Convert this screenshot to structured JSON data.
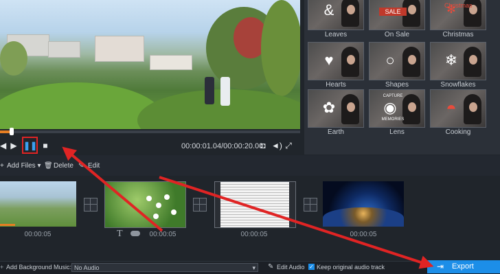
{
  "player": {
    "timecode": "00:00:01.04/00:00:20.00",
    "progress_fraction": 0.038
  },
  "effects": {
    "items": [
      {
        "label": "Leaves",
        "motif": "&"
      },
      {
        "label": "On Sale",
        "motif": "SALE"
      },
      {
        "label": "Christmas",
        "motif": "✻"
      },
      {
        "label": "Hearts",
        "motif": "♥"
      },
      {
        "label": "Shapes",
        "motif": "○"
      },
      {
        "label": "Snowflakes",
        "motif": "❄"
      },
      {
        "label": "Earth",
        "motif": "✿"
      },
      {
        "label": "Lens",
        "motif": "◉"
      },
      {
        "label": "Cooking",
        "motif": "◓"
      }
    ],
    "christmas_text": "Christmas",
    "sale_text": "SALE",
    "lens_top_text": "CAPTURE",
    "lens_bottom_text": "MEMORIES"
  },
  "toolbar": {
    "add_files": "Add Files",
    "add_files_caret": "▾",
    "delete": "Delete",
    "edit": "Edit"
  },
  "timeline": {
    "clips": [
      {
        "duration": "00:00:05"
      },
      {
        "duration": "00:00:05"
      },
      {
        "duration": "00:00:05"
      },
      {
        "duration": "00:00:05"
      }
    ],
    "text_tool": "T"
  },
  "bottom": {
    "add_bg_music_label": "Add Background Music:",
    "audio_value": "No Audio",
    "edit_audio": "Edit Audio",
    "keep_original_audio": "Keep original audio track",
    "keep_original_checked": true,
    "export": "Export"
  },
  "colors": {
    "accent": "#1c8ee8",
    "progress": "#e67e22",
    "annotation": "#e02424"
  }
}
